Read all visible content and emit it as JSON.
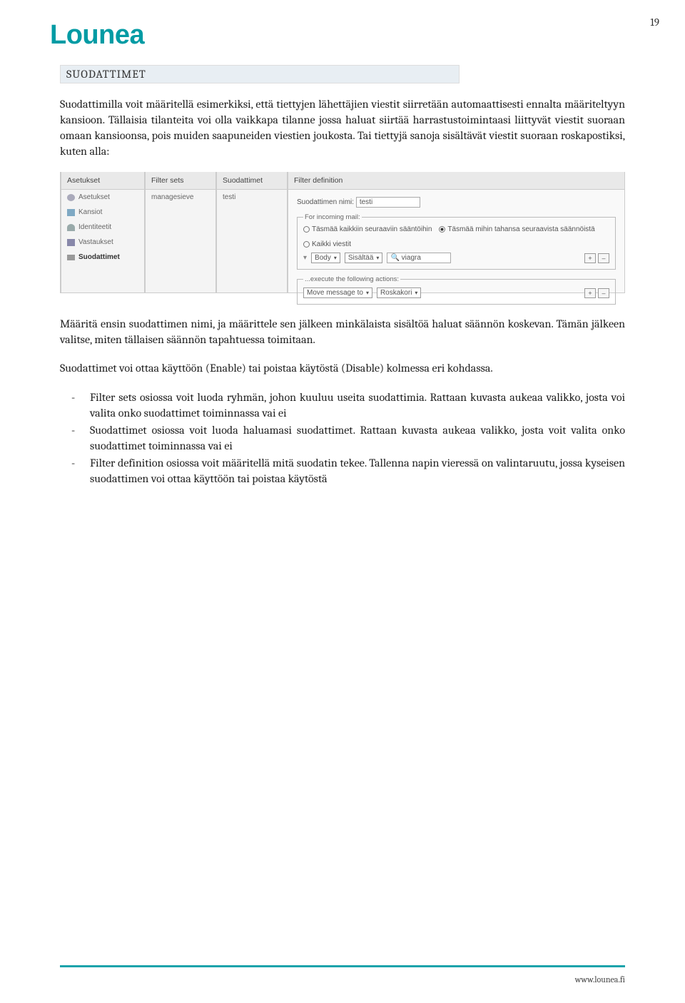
{
  "page_number": "19",
  "logo": "Lounea",
  "section_heading": "SUODATTIMET",
  "para1": "Suodattimilla voit määritellä esimerkiksi, että tiettyjen lähettäjien viestit siirretään automaattisesti ennalta määriteltyyn kansioon. Tällaisia tilanteita voi olla vaikkapa tilanne jossa haluat siirtää harrastustoimintaasi liittyvät viestit suoraan omaan kansioonsa, pois muiden saapuneiden viestien joukosta. Tai tiettyjä sanoja sisältävät viestit suoraan roskapostiksi, kuten alla:",
  "para2": "Määritä ensin suodattimen nimi, ja määrittele sen jälkeen minkälaista sisältöä haluat säännön koskevan. Tämän jälkeen valitse, miten tällaisen säännön tapahtuessa toimitaan.",
  "para3": "Suodattimet voi ottaa käyttöön (Enable) tai poistaa käytöstä (Disable) kolmessa eri kohdassa.",
  "bullets": [
    "Filter sets osiossa voit luoda ryhmän, johon kuuluu useita suodattimia. Rattaan kuvasta aukeaa valikko, josta voi valita onko suodattimet toiminnassa vai ei",
    "Suodattimet osiossa voit luoda haluamasi suodattimet. Rattaan kuvasta aukeaa valikko, josta voit valita onko suodattimet toiminnassa vai ei",
    "Filter definition osiossa voit määritellä mitä suodatin tekee. Tallenna napin vieressä on valintaruutu, jossa kyseisen suodattimen voi ottaa käyttöön tai poistaa käytöstä"
  ],
  "screenshot": {
    "cols": {
      "settings_header": "Asetukset",
      "settings_items": [
        "Asetukset",
        "Kansiot",
        "Identiteetit",
        "Vastaukset",
        "Suodattimet"
      ],
      "filtersets_header": "Filter sets",
      "filtersets_items": [
        "managesieve"
      ],
      "suodattimet_header": "Suodattimet",
      "suodattimet_items": [
        "testi"
      ],
      "def_header": "Filter definition"
    },
    "def": {
      "name_label": "Suodattimen nimi:",
      "name_value": "testi",
      "legend1": "For incoming mail:",
      "radios": [
        "Täsmää kaikkiin seuraaviin sääntöihin",
        "Täsmää mihin tahansa seuraavista säännöistä",
        "Kaikki viestit"
      ],
      "body_sel": "Body",
      "contains_sel": "Sisältää",
      "value_input": "viagra",
      "legend2": "...execute the following actions:",
      "move_sel": "Move message to",
      "folder_sel": "Roskakori"
    }
  },
  "footer_link": "www.lounea.fi"
}
